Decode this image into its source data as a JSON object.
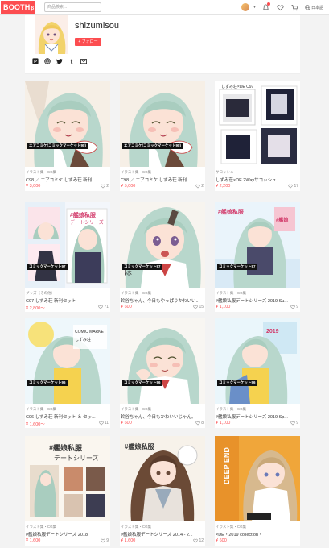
{
  "header": {
    "logo": "BOOTH",
    "logo_sup": "β",
    "search_placeholder": "商品検索...",
    "language": "日本語",
    "icons": [
      "user-avatar",
      "bell-icon",
      "heart-icon",
      "cart-icon",
      "globe-icon"
    ]
  },
  "profile": {
    "shop_name": "shizumisou",
    "follow_label": "+ フォロー",
    "social_icons": [
      "pixiv-icon",
      "globe-icon",
      "twitter-icon",
      "tumblr-icon",
      "mail-icon"
    ]
  },
  "colors": {
    "brand": "#fc4d50",
    "badge": "#111111"
  },
  "items": [
    {
      "badge": "エアコミケ(コミックマーケット98)",
      "category": "イラスト集・CG集",
      "title": "C98 ／ エアコミケ しずみ荘 新刊...",
      "price": "¥ 3,000",
      "likes": "2"
    },
    {
      "badge": "エアコミケ(コミックマーケット98)",
      "category": "イラスト集・CG集",
      "title": "C98 ／ エアコミケ しずみ荘 新刊...",
      "price": "¥ 5,000",
      "likes": "2"
    },
    {
      "badge": "",
      "category": "サコッシュ",
      "title": "しずみ荘×DE 2Wayサコッシュ",
      "price": "¥ 2,200",
      "likes": "17"
    },
    {
      "badge": "コミックマーケット97",
      "category": "グッズ（その他）",
      "title": "C97 しずみ荘 新刊セット",
      "price": "¥ 2,800～",
      "likes": "71"
    },
    {
      "badge": "コミックマーケット97",
      "category": "イラスト集・CG集",
      "title": "鈴谷ちゃん、今日もやっぱりかわいい...",
      "price": "¥ 600",
      "likes": "15"
    },
    {
      "badge": "コミックマーケット97",
      "category": "イラスト集・CG集",
      "title": "#艦娘私服デートシリーズ 2019 Su...",
      "price": "¥ 1,100",
      "likes": "9"
    },
    {
      "badge": "コミックマーケット96",
      "category": "イラスト集・CG集",
      "title": "C96 しずみ荘 新刊セット ＆ セッ...",
      "price": "¥ 1,600～",
      "likes": "11"
    },
    {
      "badge": "コミックマーケット96",
      "category": "イラスト集・CG集",
      "title": "鈴谷ちゃん、今日もかわいいじゃん。",
      "price": "¥ 600",
      "likes": "8"
    },
    {
      "badge": "コミックマーケット96",
      "category": "イラスト集・CG集",
      "title": "#艦娘私服デートシリーズ 2019 Sp...",
      "price": "¥ 1,100",
      "likes": "9"
    },
    {
      "badge": "",
      "category": "イラスト集・CG集",
      "title": "#艦娘私服デートシリーズ 2018",
      "price": "¥ 1,600",
      "likes": "9"
    },
    {
      "badge": "",
      "category": "イラスト集・CG集",
      "title": "#艦娘私服デートシリーズ 2014 - 2...",
      "price": "¥ 1,600",
      "likes": "12"
    },
    {
      "badge": "",
      "category": "イラスト集・CG集",
      "title": "×DE・2019 collection・",
      "price": "¥ 600",
      "likes": ""
    }
  ]
}
